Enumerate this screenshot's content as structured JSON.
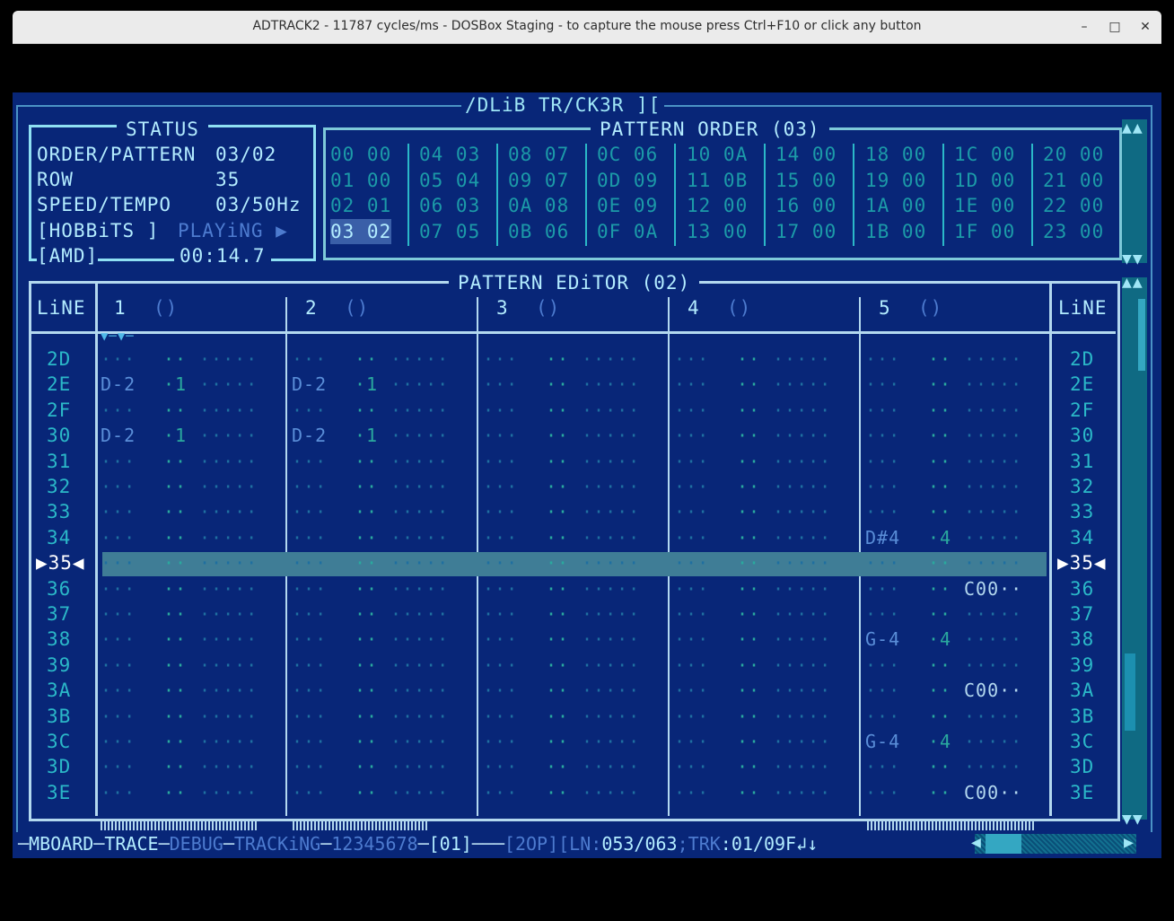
{
  "window": {
    "title": "ADTRACK2 - 11787 cycles/ms - DOSBox Staging - to capture the mouse press Ctrl+F10 or click any button"
  },
  "app_title": "DLiB TR/CK3R ][",
  "status": {
    "title": "STATUS",
    "order_pattern_label": "ORDER/PATTERN",
    "order_pattern": "03/02",
    "row_label": "ROW",
    "row": "35",
    "speed_label": "SPEED/TEMPO",
    "speed": "03/50Hz",
    "song_name": "[HOBBiTS ]",
    "state": "PLAYiNG ▶",
    "chip": "[AMD]",
    "time": "00:14.7"
  },
  "pattern_order": {
    "title": "PATTERN ORDER (03)",
    "columns": [
      [
        "00 00",
        "01 00",
        "02 01",
        "03 02"
      ],
      [
        "04 03",
        "05 04",
        "06 03",
        "07 05"
      ],
      [
        "08 07",
        "09 07",
        "0A 08",
        "0B 06"
      ],
      [
        "0C 06",
        "0D 09",
        "0E 09",
        "0F 0A"
      ],
      [
        "10 0A",
        "11 0B",
        "12 00",
        "13 00"
      ],
      [
        "14 00",
        "15 00",
        "16 00",
        "17 00"
      ],
      [
        "18 00",
        "19 00",
        "1A 00",
        "1B 00"
      ],
      [
        "1C 00",
        "1D 00",
        "1E 00",
        "1F 00"
      ],
      [
        "20 00",
        "21 00",
        "22 00",
        "23 00"
      ]
    ],
    "current": "03",
    "current_pattern": "02"
  },
  "pattern_editor": {
    "title": "PATTERN EDiTOR (02)",
    "line_label": "LiNE",
    "channels": [
      "1",
      "2",
      "3",
      "4",
      "5"
    ],
    "channel_icon": "()",
    "rows": [
      "2D",
      "2E",
      "2F",
      "30",
      "31",
      "32",
      "33",
      "34",
      "35",
      "36",
      "37",
      "38",
      "39",
      "3A",
      "3B",
      "3C",
      "3D",
      "3E"
    ],
    "current_row": "35",
    "cells": {
      "c1": [
        "··· ·· ·····",
        "D-2 ·1 ·····",
        "··· ·· ·····",
        "D-2 ·1 ·····",
        "··· ·· ·····",
        "··· ·· ·····",
        "··· ·· ·····",
        "··· ·· ·····",
        "··· ·· ·····",
        "··· ·· ·····",
        "··· ·· ·····",
        "··· ·· ·····",
        "··· ·· ·····",
        "··· ·· ·····",
        "··· ·· ·····",
        "··· ·· ·····",
        "··· ·· ·····",
        "··· ·· ·····"
      ],
      "c2": [
        "··· ·· ·····",
        "D-2 ·1 ·····",
        "··· ·· ·····",
        "D-2 ·1 ·····",
        "··· ·· ·····",
        "··· ·· ·····",
        "··· ·· ·····",
        "··· ·· ·····",
        "··· ·· ·····",
        "··· ·· ·····",
        "··· ·· ·····",
        "··· ·· ·····",
        "··· ·· ·····",
        "··· ·· ·····",
        "··· ·· ·····",
        "··· ·· ·····",
        "··· ·· ·····",
        "··· ·· ·····"
      ],
      "c3": [
        "··· ·· ·····",
        "··· ·· ·····",
        "··· ·· ·····",
        "··· ·· ·····",
        "··· ·· ·····",
        "··· ·· ·····",
        "··· ·· ·····",
        "··· ·· ·····",
        "··· ·· ·····",
        "··· ·· ·····",
        "··· ·· ·····",
        "··· ·· ·····",
        "··· ·· ·····",
        "··· ·· ·····",
        "··· ·· ·····",
        "··· ·· ·····",
        "··· ·· ·····",
        "··· ·· ·····"
      ],
      "c4": [
        "··· ·· ·····",
        "··· ·· ·····",
        "··· ·· ·····",
        "··· ·· ·····",
        "··· ·· ·····",
        "··· ·· ·····",
        "··· ·· ·····",
        "··· ·· ·····",
        "··· ·· ·····",
        "··· ·· ·····",
        "··· ·· ·····",
        "··· ·· ·····",
        "··· ·· ·····",
        "··· ·· ·····",
        "··· ·· ·····",
        "··· ·· ·····",
        "··· ·· ·····",
        "··· ·· ·····"
      ],
      "c5": [
        "··· ·· ·····",
        "··· ·· ·····",
        "··· ·· ·····",
        "··· ·· ·····",
        "··· ·· ·····",
        "··· ·· ·····",
        "··· ·· ·····",
        "D#4 ·4 ·····",
        "··· ·· ·····",
        "··· ·· C00··",
        "··· ·· ·····",
        "G-4 ·4 ·····",
        "··· ·· ·····",
        "··· ·· C00··",
        "··· ·· ·····",
        "G-4 ·4 ·····",
        "··· ·· ·····",
        "··· ·· C00··"
      ]
    }
  },
  "statusbar": {
    "mboard": "MBOARD",
    "trace": "TRACE",
    "debug": "DEBUG",
    "tracking": "TRACKiNG",
    "channels": "12345678",
    "octave": "[01]",
    "op": "[2OP]",
    "ln_label": "[LN:",
    "ln": "053/063",
    "trk_label": "TRK",
    "trk": "01/09",
    "flags": "F↲↓"
  }
}
